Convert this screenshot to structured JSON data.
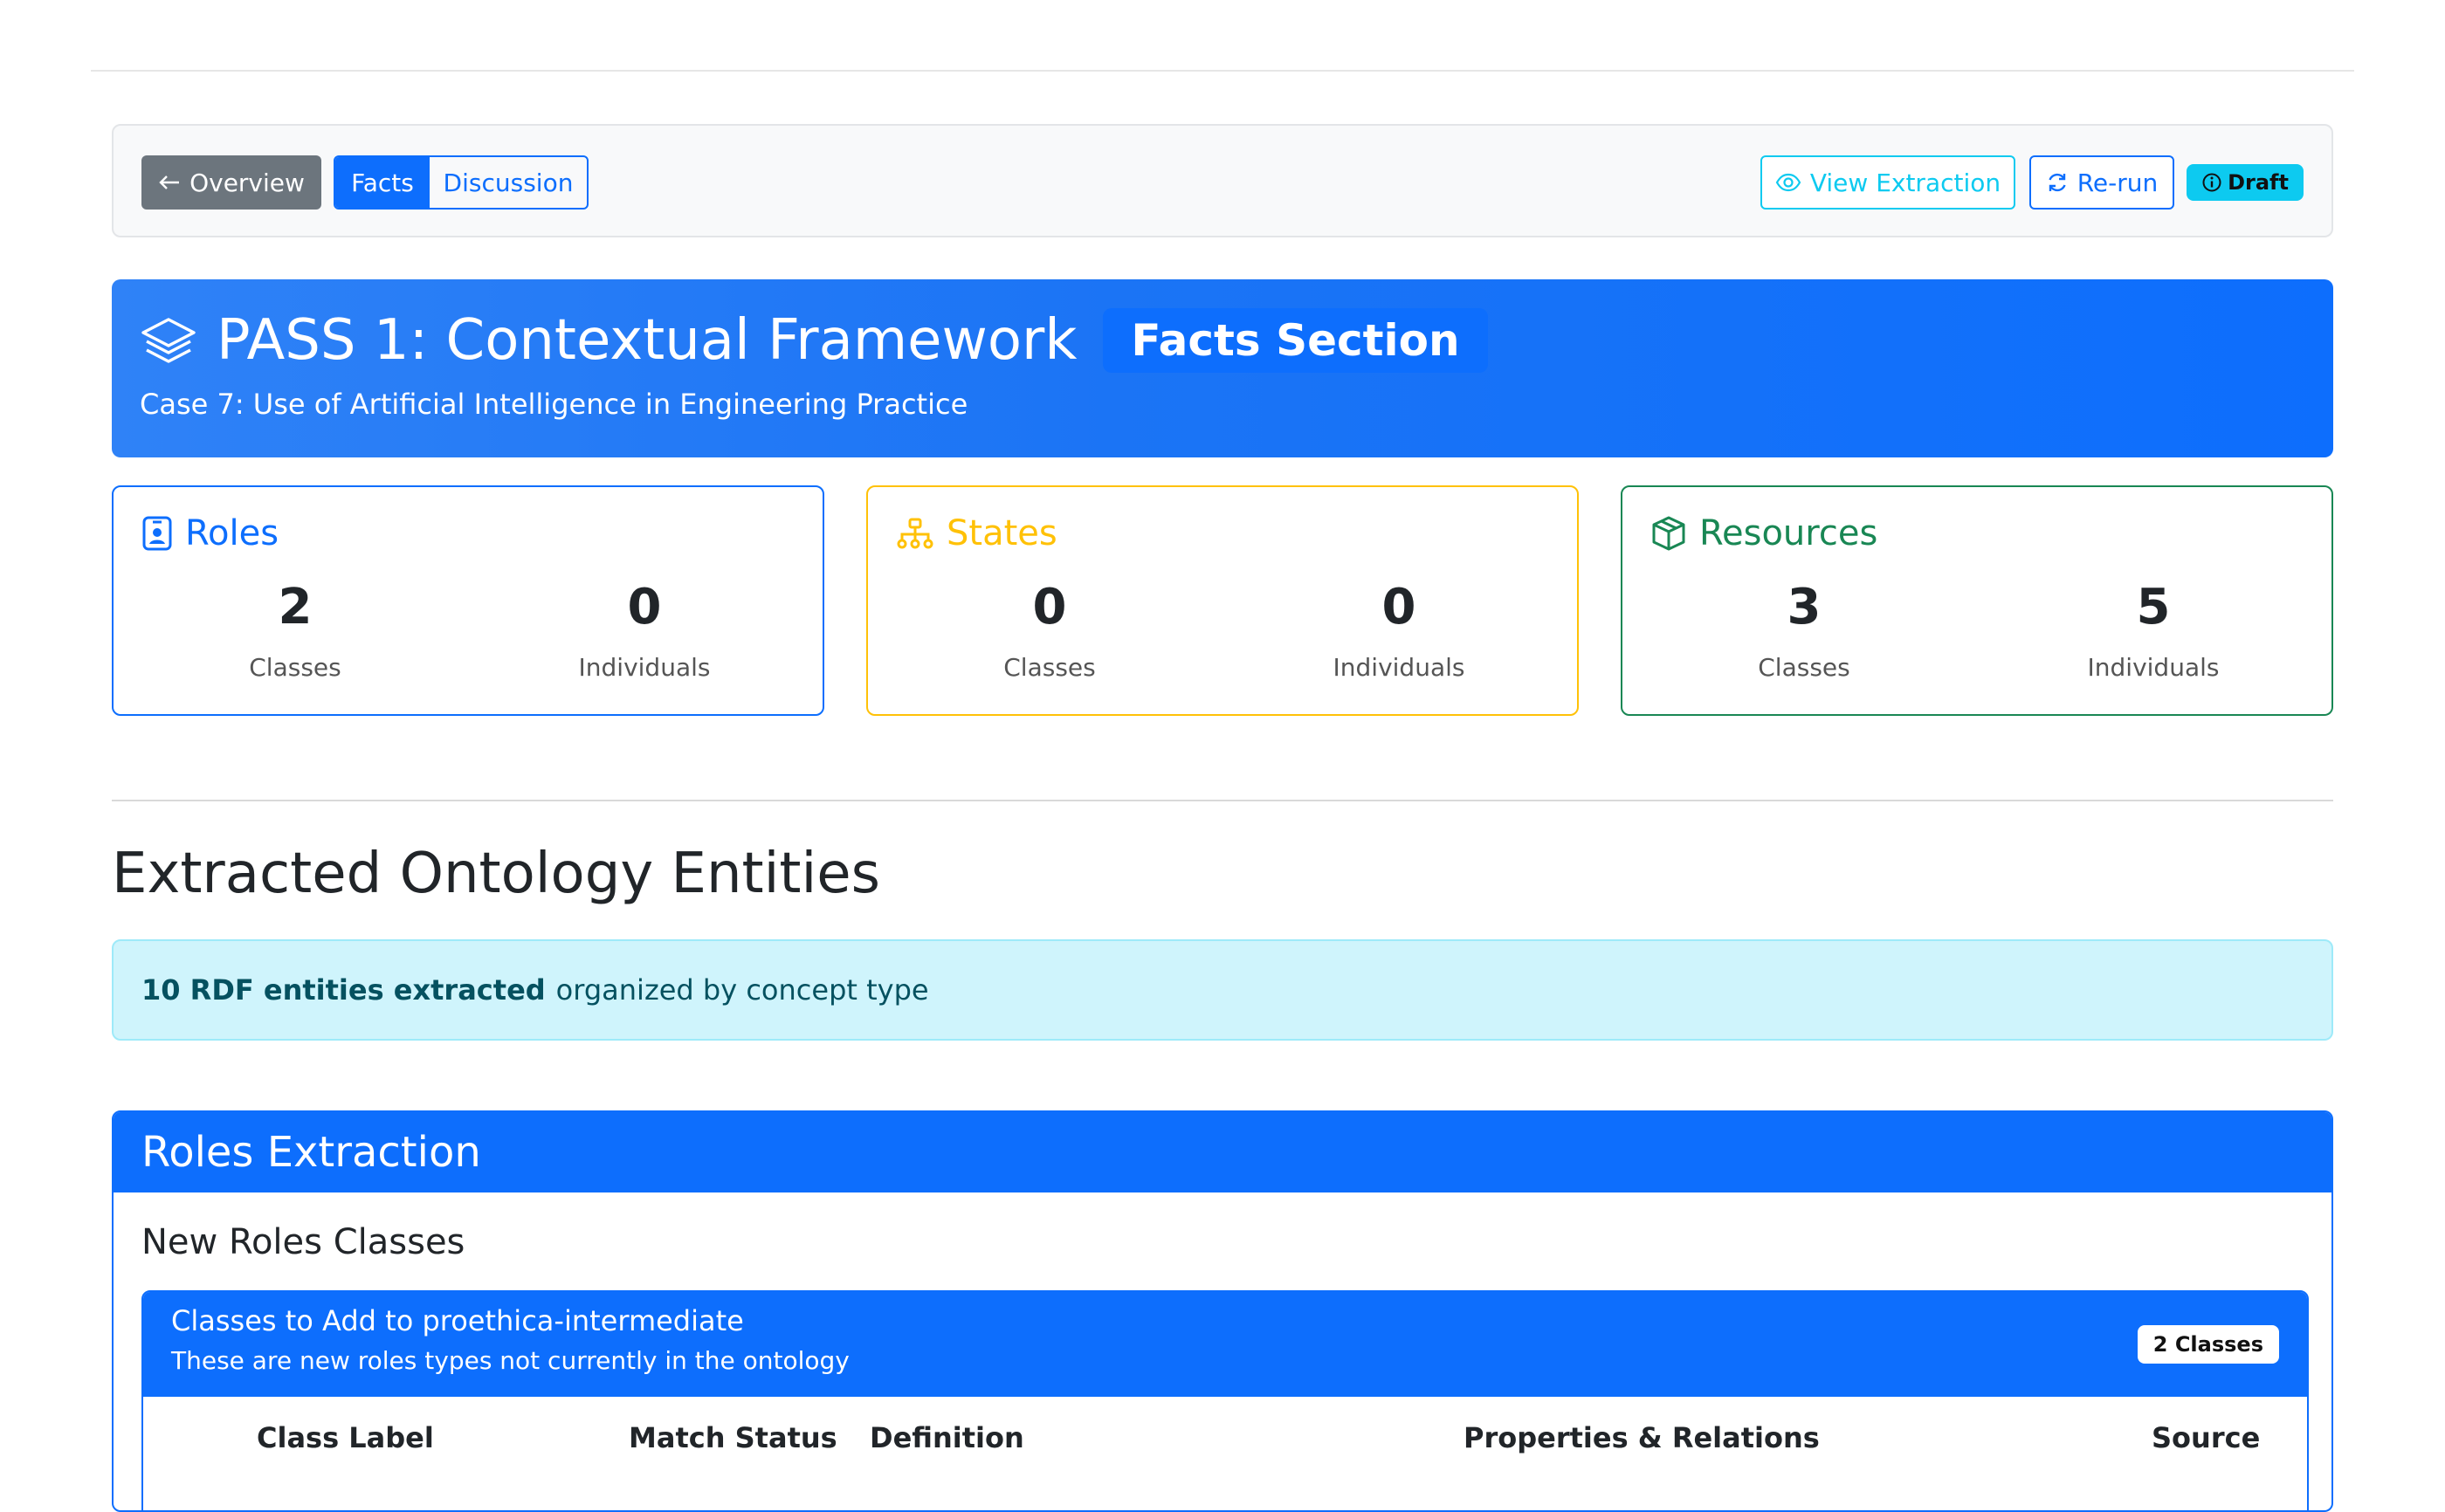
{
  "header": {
    "title": "PASS 1: Contextual Framework",
    "section_badge": "Facts Section",
    "case": "Case 7: Use of Artificial Intelligence in Engineering Practice"
  },
  "toolbar": {
    "overview_label": "Overview",
    "tabs": [
      {
        "label": "Facts",
        "active": true
      },
      {
        "label": "Discussion",
        "active": false
      }
    ],
    "view_extraction_label": "View Extraction",
    "rerun_label": "Re-run",
    "status_badge": "Draft"
  },
  "stats": [
    {
      "title": "Roles",
      "icon": "person-badge-icon",
      "color": "#0d6efd",
      "classes": "2",
      "classes_label": "Classes",
      "individuals": "0",
      "individuals_label": "Individuals"
    },
    {
      "title": "States",
      "icon": "diagram-icon",
      "color": "#ffc107",
      "classes": "0",
      "classes_label": "Classes",
      "individuals": "0",
      "individuals_label": "Individuals"
    },
    {
      "title": "Resources",
      "icon": "box-icon",
      "color": "#198754",
      "classes": "3",
      "classes_label": "Classes",
      "individuals": "5",
      "individuals_label": "Individuals"
    }
  ],
  "entities": {
    "heading": "Extracted Ontology Entities",
    "summary_bold": "10 RDF entities extracted",
    "summary_rest": "organized by concept type"
  },
  "roles_extraction": {
    "title": "Roles Extraction",
    "subtitle": "New Roles Classes",
    "panel_title": "Classes to Add to proethica-intermediate",
    "panel_desc": "These are new roles types not currently in the ontology",
    "count_badge": "2 Classes",
    "columns": [
      "Class Label",
      "Match Status",
      "Definition",
      "Properties & Relations",
      "Source"
    ]
  },
  "colors": {
    "primary": "#0d6efd",
    "info": "#0dcaf0",
    "warning": "#ffc107",
    "success": "#198754",
    "secondary": "#6c757d"
  }
}
